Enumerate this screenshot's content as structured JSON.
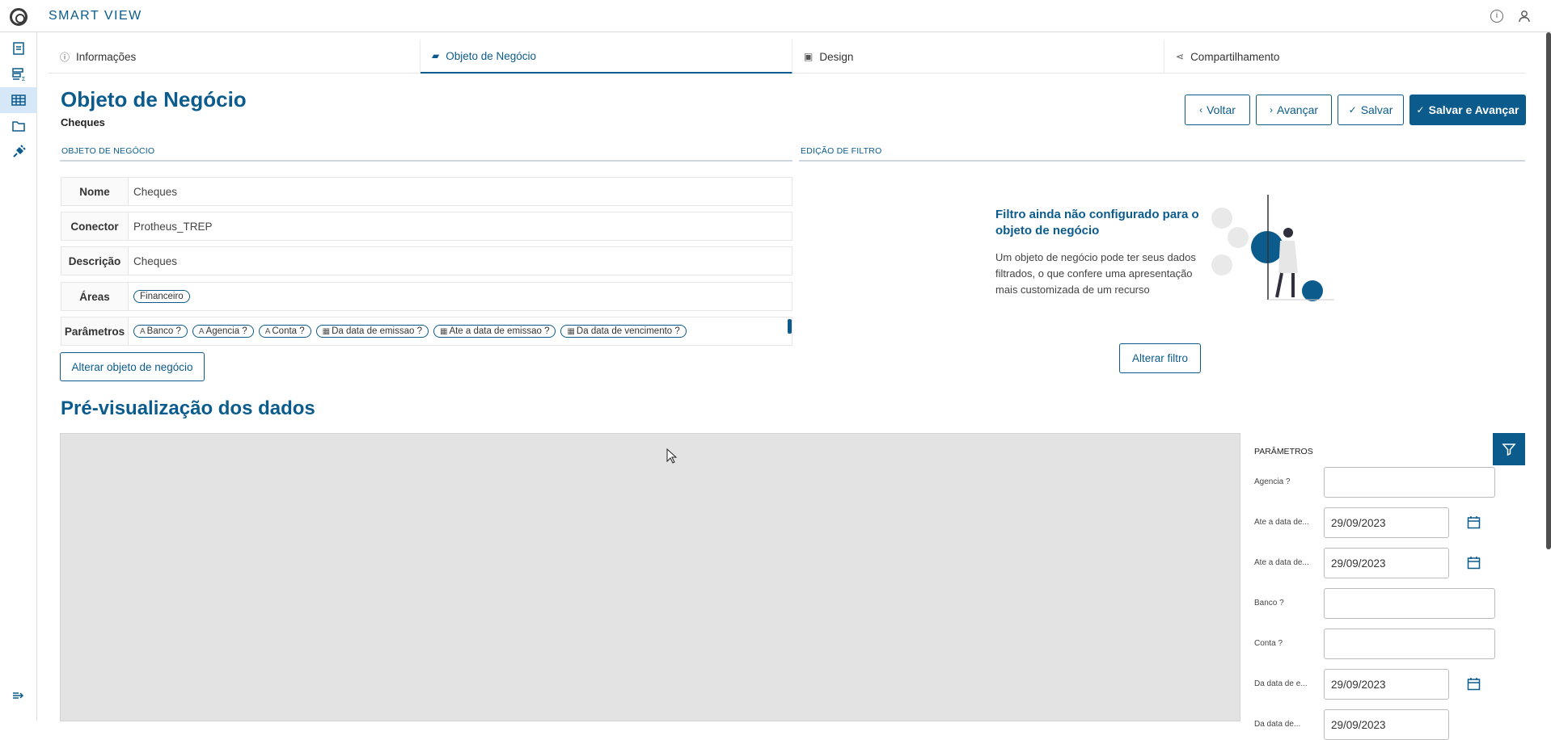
{
  "app": {
    "title": "SMART VIEW"
  },
  "icons": {
    "logo": "logo-icon",
    "info": "info-icon",
    "user": "user-icon"
  },
  "sidebar": {
    "items": [
      {
        "icon": "document-icon",
        "active": false
      },
      {
        "icon": "list-sum-icon",
        "active": false
      },
      {
        "icon": "table-icon",
        "active": true
      },
      {
        "icon": "folder-icon",
        "active": false
      },
      {
        "icon": "plug-icon",
        "active": false
      }
    ],
    "collapse_icon": "collapse-menu-icon"
  },
  "tabs": [
    {
      "label": "Informações",
      "icon": "info-icon",
      "active": false
    },
    {
      "label": "Objeto de Negócio",
      "icon": "briefcase-icon",
      "active": true
    },
    {
      "label": "Design",
      "icon": "image-icon",
      "active": false
    },
    {
      "label": "Compartilhamento",
      "icon": "share-icon",
      "active": false
    }
  ],
  "header": {
    "title": "Objeto de Negócio",
    "subtitle": "Cheques"
  },
  "actions": {
    "back": "Voltar",
    "next": "Avançar",
    "save": "Salvar",
    "save_next": "Salvar e Avançar"
  },
  "business_object": {
    "section_label": "OBJETO DE NEGÓCIO",
    "fields": {
      "name_label": "Nome",
      "name_value": "Cheques",
      "connector_label": "Conector",
      "connector_value": "Protheus_TREP",
      "description_label": "Descrição",
      "description_value": "Cheques",
      "areas_label": "Áreas",
      "areas_chip": "Financeiro",
      "params_label": "Parâmetros"
    },
    "param_chips": [
      {
        "label": "Banco ?",
        "type": "text"
      },
      {
        "label": "Agencia ?",
        "type": "text"
      },
      {
        "label": "Conta ?",
        "type": "text"
      },
      {
        "label": "Da data de emissao ?",
        "type": "date"
      },
      {
        "label": "Ate a data de emissao ?",
        "type": "date"
      },
      {
        "label": "Da data de vencimento ?",
        "type": "date"
      }
    ],
    "change_button": "Alterar objeto de negócio"
  },
  "filter": {
    "section_label": "EDIÇÃO DE FILTRO",
    "title": "Filtro ainda não configurado para o objeto de negócio",
    "description": "Um objeto de negócio pode ter seus dados filtrados, o que confere uma apresentação mais customizada de um recurso",
    "change_button": "Alterar filtro"
  },
  "preview": {
    "title": "Pré-visualização dos dados",
    "params_header": "PARÂMETROS",
    "params": [
      {
        "label": "Agencia ?",
        "value": "",
        "type": "text"
      },
      {
        "label": "Ate a data de...",
        "value": "29/09/2023",
        "type": "date"
      },
      {
        "label": "Ate a data de...",
        "value": "29/09/2023",
        "type": "date"
      },
      {
        "label": "Banco ?",
        "value": "",
        "type": "text"
      },
      {
        "label": "Conta ?",
        "value": "",
        "type": "text"
      },
      {
        "label": "Da data de e...",
        "value": "29/09/2023",
        "type": "date"
      },
      {
        "label": "Da data de...",
        "value": "29/09/2023",
        "type": "date"
      }
    ]
  },
  "colors": {
    "primary": "#0b5b8c",
    "active_sidebar": "#d6e8f7",
    "preview_bg": "#e3e3e3"
  }
}
